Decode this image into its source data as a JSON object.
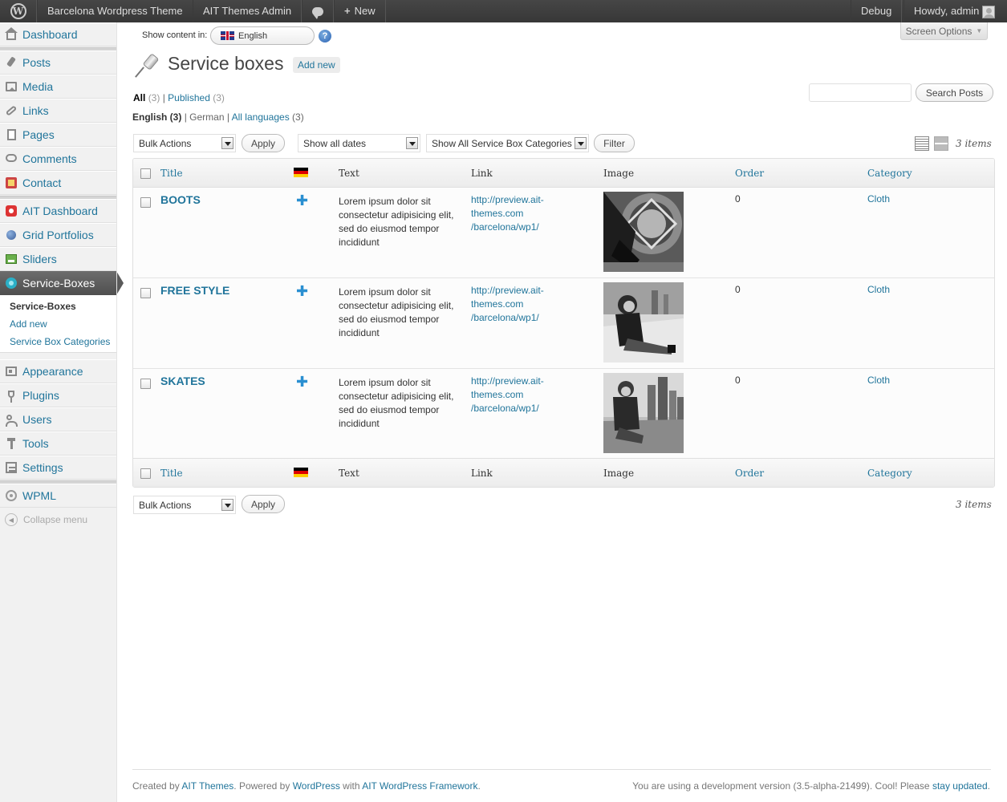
{
  "adminbar": {
    "site_name": "Barcelona Wordpress Theme",
    "ait_admin": "AIT Themes Admin",
    "new_label": "New",
    "debug": "Debug",
    "howdy": "Howdy, admin"
  },
  "sidebar": {
    "dashboard": "Dashboard",
    "posts": "Posts",
    "media": "Media",
    "links": "Links",
    "pages": "Pages",
    "comments": "Comments",
    "contact": "Contact",
    "ait_dashboard": "AIT Dashboard",
    "grid_portfolios": "Grid Portfolios",
    "sliders": "Sliders",
    "service_boxes": "Service-Boxes",
    "sub_service_boxes": "Service-Boxes",
    "sub_add_new": "Add new",
    "sub_categories": "Service Box Categories",
    "appearance": "Appearance",
    "plugins": "Plugins",
    "users": "Users",
    "tools": "Tools",
    "settings": "Settings",
    "wpml": "WPML",
    "collapse": "Collapse menu"
  },
  "top": {
    "show_content_in": "Show content in:",
    "language": "English",
    "screen_options": "Screen Options"
  },
  "page": {
    "title": "Service boxes",
    "add_new": "Add new"
  },
  "filters": {
    "all": "All",
    "all_count": "(3)",
    "published": "Published",
    "published_count": "(3)",
    "lang_english": "English (3)",
    "lang_german": "German",
    "lang_all": "All languages",
    "lang_all_count": "(3)",
    "search_button": "Search Posts",
    "bulk_actions": "Bulk Actions",
    "apply": "Apply",
    "dates": "Show all dates",
    "categories": "Show All Service Box Categories",
    "filter": "Filter",
    "items": "3 items"
  },
  "table": {
    "columns": {
      "title": "Title",
      "text": "Text",
      "link": "Link",
      "image": "Image",
      "order": "Order",
      "category": "Category"
    },
    "rows": [
      {
        "title": "BOOTS",
        "text": "Lorem ipsum dolor sit consectetur adipisicing elit, sed do eiusmod tempor incididunt",
        "link": "http://preview.ait-themes.com/barcelona/wp1/",
        "order": "0",
        "category": "Cloth"
      },
      {
        "title": "FREE STYLE",
        "text": "Lorem ipsum dolor sit consectetur adipisicing elit, sed do eiusmod tempor incididunt",
        "link": "http://preview.ait-themes.com/barcelona/wp1/",
        "order": "0",
        "category": "Cloth"
      },
      {
        "title": "SKATES",
        "text": "Lorem ipsum dolor sit consectetur adipisicing elit, sed do eiusmod tempor incididunt",
        "link": "http://preview.ait-themes.com/barcelona/wp1/",
        "order": "0",
        "category": "Cloth"
      }
    ]
  },
  "footer": {
    "created_by": "Created by",
    "ait_themes": "AIT Themes",
    "powered_by": ". Powered by",
    "wordpress": "WordPress",
    "with": "with",
    "framework": "AIT WordPress Framework",
    "dot": ".",
    "dev_version": "You are using a development version (3.5-alpha-21499). Cool! Please",
    "stay_updated": "stay updated",
    "dot2": "."
  }
}
